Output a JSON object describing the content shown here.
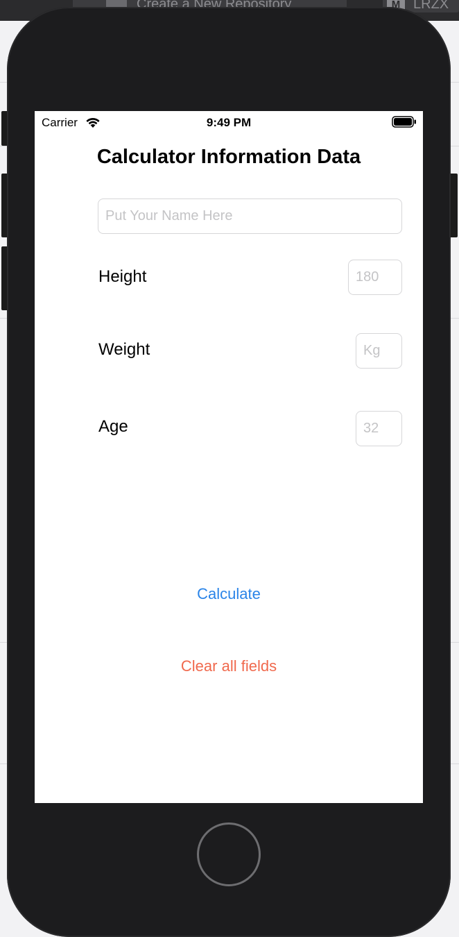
{
  "background_app": {
    "tab_repo_label": "Create a New Repository",
    "tab_user_badge": "M",
    "tab_user_label": "LRZX"
  },
  "status_bar": {
    "carrier": "Carrier",
    "time": "9:49 PM"
  },
  "page": {
    "title": "Calculator Information Data"
  },
  "form": {
    "name_placeholder": "Put Your Name Here",
    "height_label": "Height",
    "height_placeholder": "180",
    "weight_label": "Weight",
    "weight_placeholder": "Kg",
    "age_label": "Age",
    "age_placeholder": "32"
  },
  "actions": {
    "calculate_label": "Calculate",
    "clear_label": "Clear all fields"
  },
  "colors": {
    "calculate": "#2a84e8",
    "clear": "#f0694d",
    "device_bezel": "#1c1c1e"
  },
  "icons": [
    "wifi-icon",
    "battery-icon",
    "home-button"
  ]
}
